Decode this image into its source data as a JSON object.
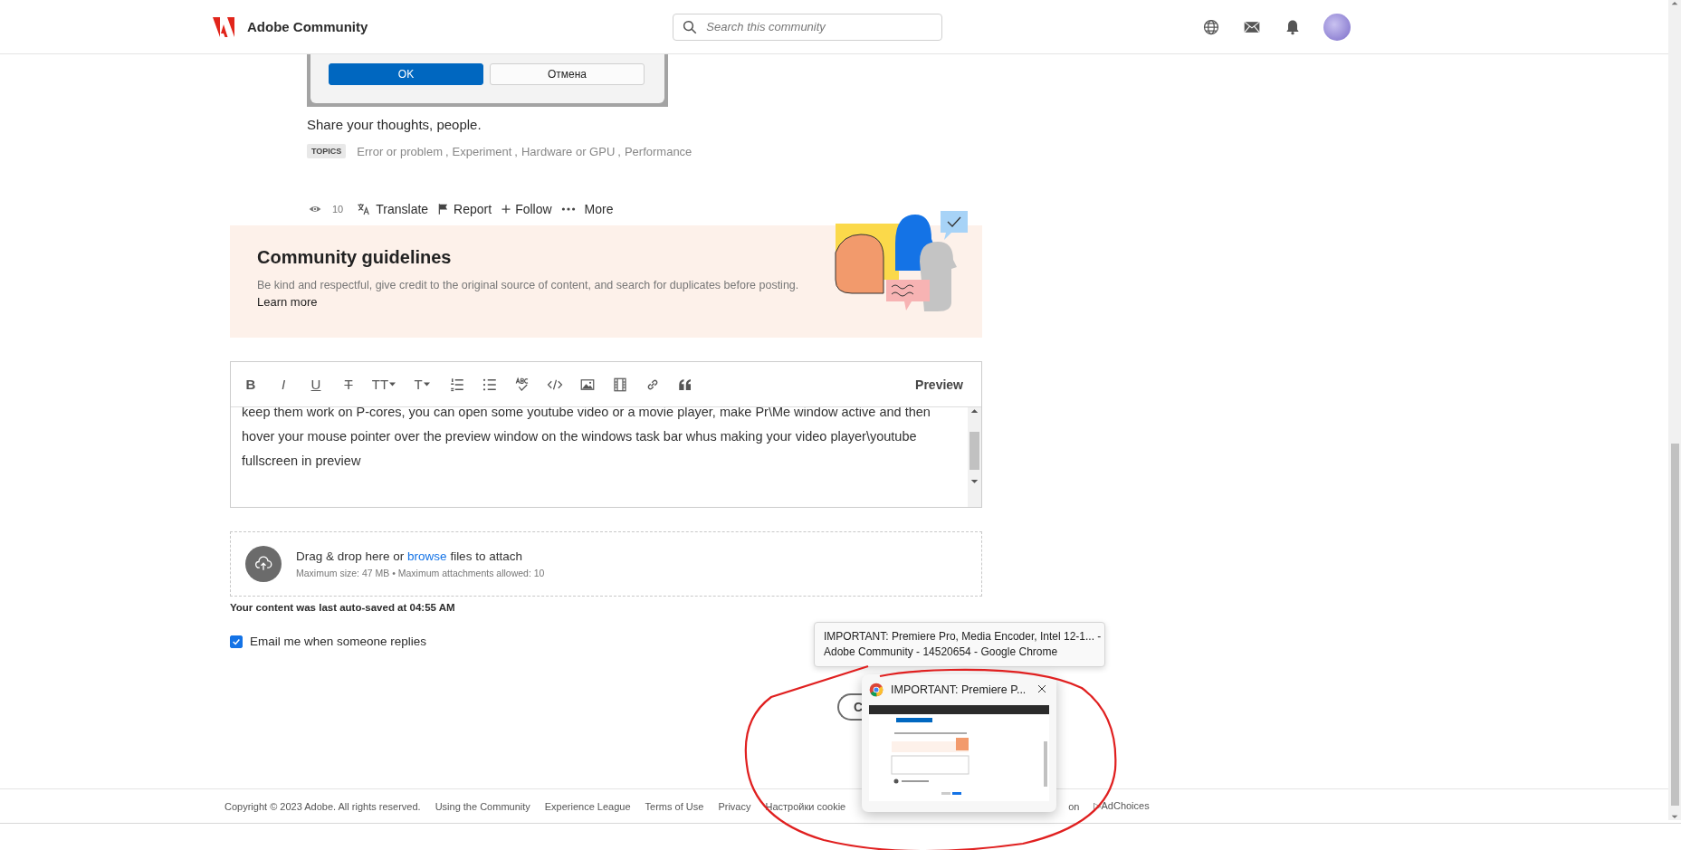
{
  "header": {
    "brand": "Adobe Community",
    "search": {
      "placeholder": "Search this community"
    }
  },
  "dialog_image": {
    "buttons": [
      {
        "label": "OK",
        "primary": true
      },
      {
        "label": "Отмена",
        "primary": false
      }
    ]
  },
  "post": {
    "body": "Share your thoughts, people.",
    "topics_label": "TOPICS",
    "topics": [
      "Error or problem",
      "Experiment",
      "Hardware or GPU",
      "Performance"
    ],
    "topic_separator": ",",
    "views": "10",
    "actions": [
      {
        "kind": "translate",
        "label": "Translate"
      },
      {
        "kind": "report",
        "label": "Report"
      },
      {
        "kind": "follow",
        "label": "Follow"
      },
      {
        "kind": "more",
        "label": "More"
      }
    ]
  },
  "guidelines": {
    "title": "Community guidelines",
    "text": "Be kind and respectful, give credit to the original source of content, and search for duplicates before posting.",
    "link": "Learn more"
  },
  "editor": {
    "toolbar": [
      {
        "kind": "bold",
        "glyph": "B"
      },
      {
        "kind": "italic",
        "glyph": "I"
      },
      {
        "kind": "underline",
        "glyph": "U"
      },
      {
        "kind": "strikethrough",
        "glyph": "T"
      },
      {
        "kind": "font-size",
        "glyph": "TT"
      },
      {
        "kind": "text-format",
        "glyph": "T"
      },
      {
        "kind": "ordered-list"
      },
      {
        "kind": "bullet-list"
      },
      {
        "kind": "spellcheck"
      },
      {
        "kind": "code"
      },
      {
        "kind": "image"
      },
      {
        "kind": "video"
      },
      {
        "kind": "link"
      },
      {
        "kind": "quote"
      }
    ],
    "preview": "Preview",
    "text": "keep them work on P-cores, you can open some youtube video or a movie player, make Pr\\Me window active and then hover your mouse pointer over the preview window on the windows task bar whus making your video player\\youtube fullscreen in preview"
  },
  "attach": {
    "text_before": "Drag & drop here or",
    "link": "browse",
    "text_after": "files to attach",
    "limits": "Maximum size: 47 MB • Maximum attachments allowed: 10"
  },
  "autosave": "Your content was last auto-saved at 04:55 AM",
  "email_option": {
    "label": "Email me when someone replies",
    "checked": true
  },
  "form_buttons": [
    {
      "label": "C"
    }
  ],
  "footer": {
    "links": [
      "Copyright © 2023 Adobe. All rights reserved.",
      "Using the Community",
      "Experience League",
      "Terms of Use",
      "Privacy",
      "Настройки cookie"
    ],
    "partial": "on",
    "adchoices": "▷AdChoices"
  },
  "taskbar_tooltip": {
    "lines": [
      "IMPORTANT: Premiere Pro, Media Encoder, Intel 12-1... -",
      "Adobe Community - 14520654 - Google Chrome"
    ]
  },
  "taskbar_preview": {
    "title": "IMPORTANT: Premiere P..."
  }
}
